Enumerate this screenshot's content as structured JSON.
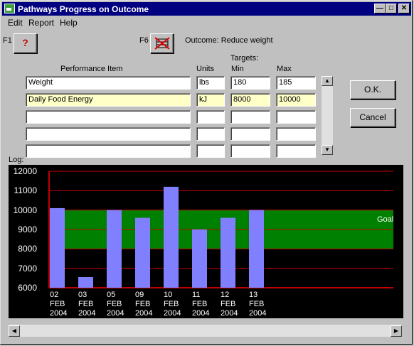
{
  "window": {
    "title": "Pathways Progress on Outcome"
  },
  "menu": [
    "Edit",
    "Report",
    "Help"
  ],
  "toolbar": {
    "f1": "F1",
    "f6": "F6",
    "outcome_text": "Outcome: Reduce weight"
  },
  "form": {
    "headers": {
      "item": "Performance Item",
      "units": "Units",
      "targets": "Targets:",
      "min": "Min",
      "max": "Max"
    },
    "rows": [
      {
        "item": "Weight",
        "units": "lbs",
        "min": "180",
        "max": "185"
      },
      {
        "item": "Daily Food Energy",
        "units": "kJ",
        "min": "8000",
        "max": "10000"
      },
      {
        "item": "",
        "units": "",
        "min": "",
        "max": ""
      },
      {
        "item": "",
        "units": "",
        "min": "",
        "max": ""
      },
      {
        "item": "",
        "units": "",
        "min": "",
        "max": ""
      }
    ]
  },
  "buttons": {
    "ok": "O.K.",
    "cancel": "Cancel"
  },
  "log_label": "Log:",
  "colors": {
    "bar": "#8080ff",
    "goal_band": "#008000",
    "grid": "#c00000",
    "background": "#000000"
  },
  "chart_data": {
    "type": "bar",
    "categories": [
      [
        "02",
        "FEB",
        "2004"
      ],
      [
        "03",
        "FEB",
        "2004"
      ],
      [
        "05",
        "FEB",
        "2004"
      ],
      [
        "09",
        "FEB",
        "2004"
      ],
      [
        "10",
        "FEB",
        "2004"
      ],
      [
        "11",
        "FEB",
        "2004"
      ],
      [
        "12",
        "FEB",
        "2004"
      ],
      [
        "13",
        "FEB",
        "2004"
      ]
    ],
    "values": [
      10100,
      6550,
      10000,
      9600,
      11200,
      9000,
      9600,
      10000
    ],
    "ylim": [
      6000,
      12000
    ],
    "yticks": [
      6000,
      7000,
      8000,
      9000,
      10000,
      11000,
      12000
    ],
    "goal_band": {
      "min": 8000,
      "max": 10000,
      "label": "Goal"
    },
    "grid": true
  }
}
